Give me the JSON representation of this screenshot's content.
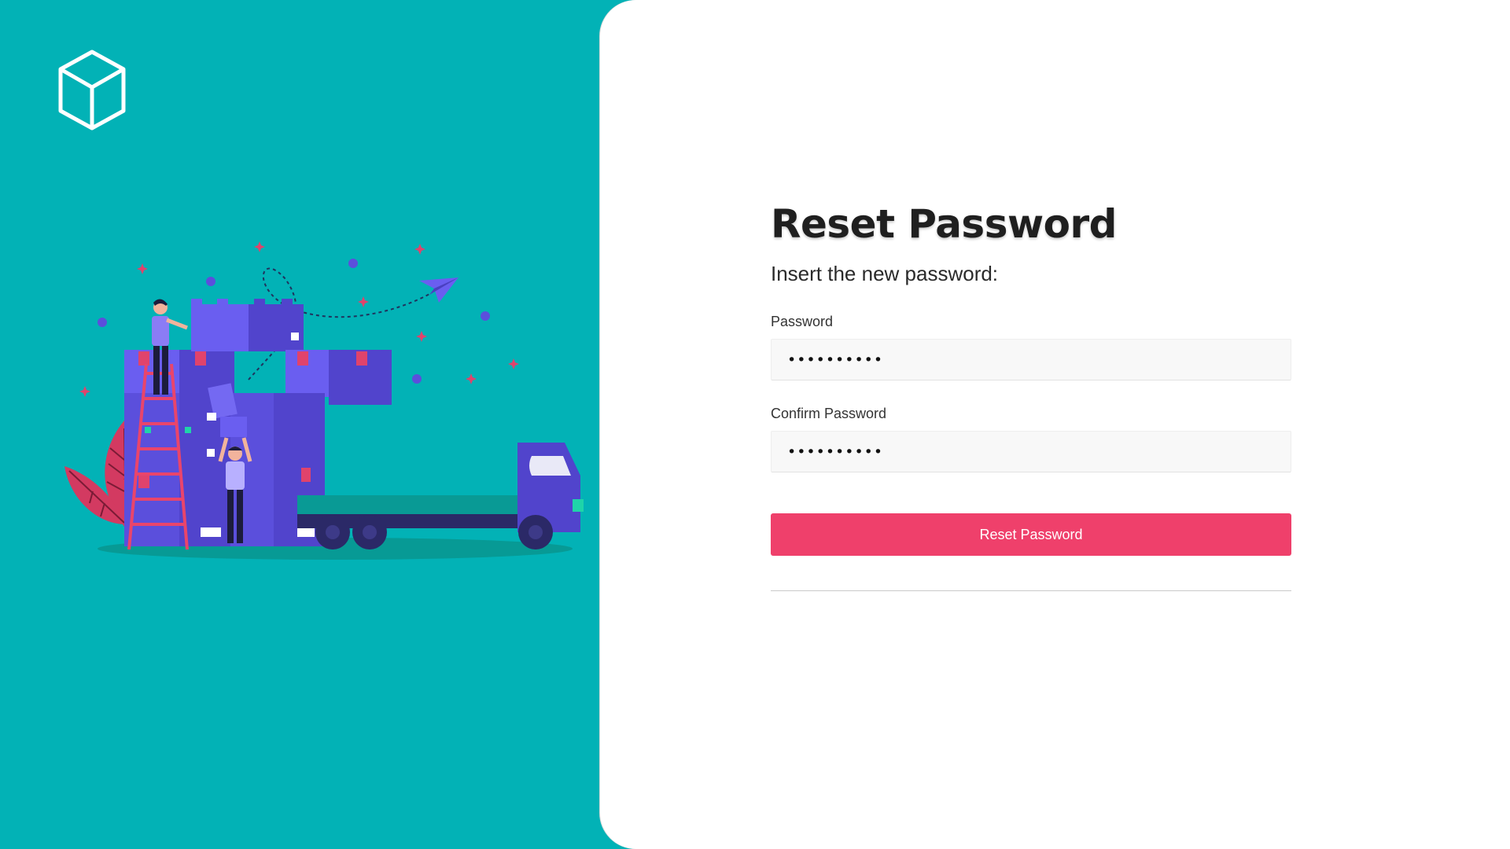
{
  "left_panel": {
    "logo_icon": "cube-outline-icon",
    "illustration": "delivery-truck-loading-boxes"
  },
  "form": {
    "title": "Reset Password",
    "subtitle": "Insert the new password:",
    "password": {
      "label": "Password",
      "value": "••••••••••"
    },
    "confirm_password": {
      "label": "Confirm Password",
      "value": "••••••••••"
    },
    "submit_label": "Reset Password"
  },
  "colors": {
    "background_teal": "#02b2b6",
    "accent_pink": "#ef406b",
    "box_purple": "#5b4fdc",
    "truck_navy": "#2b2967"
  }
}
